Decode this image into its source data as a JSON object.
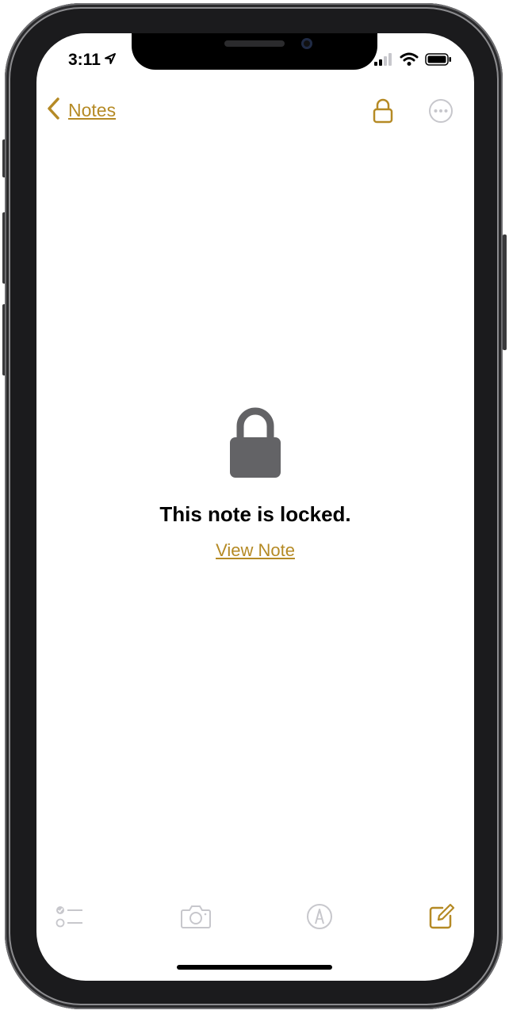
{
  "status_bar": {
    "time": "3:11",
    "location_icon": "location-arrow-icon",
    "signal_icon": "cellular-signal-icon",
    "wifi_icon": "wifi-icon",
    "battery_icon": "battery-icon"
  },
  "nav": {
    "back_label": "Notes",
    "back_icon": "chevron-left-icon",
    "lock_icon": "lock-icon",
    "more_icon": "more-ellipsis-icon"
  },
  "content": {
    "lock_icon": "lock-icon",
    "title": "This note is locked.",
    "view_note_label": "View Note"
  },
  "toolbar": {
    "items": [
      {
        "icon": "checklist-icon",
        "enabled": false
      },
      {
        "icon": "camera-icon",
        "enabled": false
      },
      {
        "icon": "markup-pen-icon",
        "enabled": false
      },
      {
        "icon": "compose-icon",
        "enabled": true
      }
    ]
  },
  "colors": {
    "accent": "#b58a25",
    "disabled": "#c7c7cc",
    "lock_glyph": "#636366"
  }
}
